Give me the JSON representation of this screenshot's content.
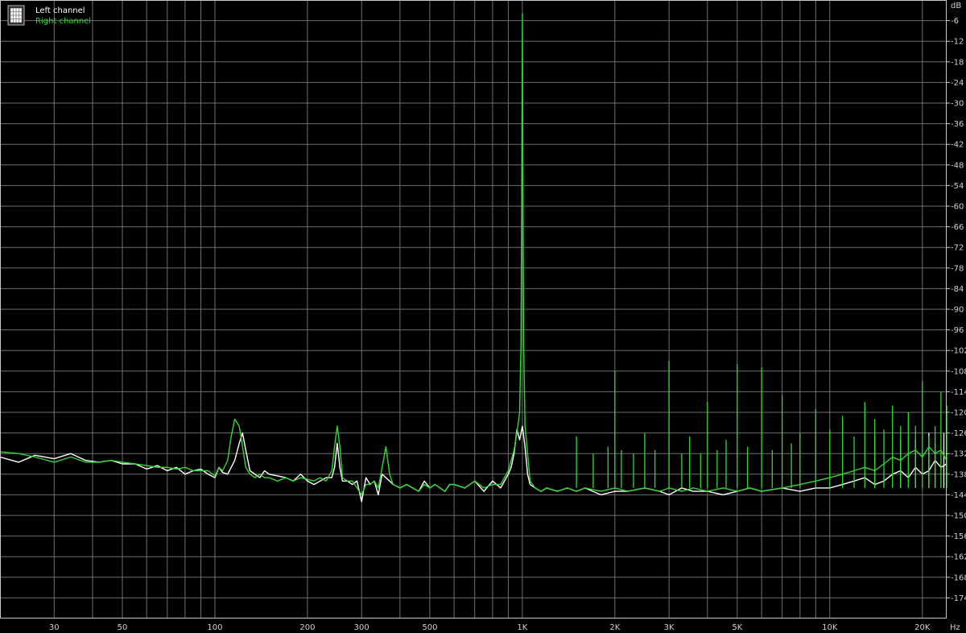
{
  "chart_data": {
    "type": "line",
    "xscale": "log",
    "xlim": [
      20,
      24000
    ],
    "ylim": [
      -180,
      0
    ],
    "grid": true,
    "legend": "top-left",
    "legend_icon": "grid-icon",
    "y_unit": "dB",
    "x_unit": "Hz",
    "x_ticks": [
      {
        "value": 30,
        "label": "30"
      },
      {
        "value": 50,
        "label": "50"
      },
      {
        "value": 100,
        "label": "100"
      },
      {
        "value": 200,
        "label": "200"
      },
      {
        "value": 300,
        "label": "300"
      },
      {
        "value": 500,
        "label": "500"
      },
      {
        "value": 1000,
        "label": "1K"
      },
      {
        "value": 2000,
        "label": "2K"
      },
      {
        "value": 3000,
        "label": "3K"
      },
      {
        "value": 5000,
        "label": "5K"
      },
      {
        "value": 10000,
        "label": "10K"
      },
      {
        "value": 20000,
        "label": "20K"
      }
    ],
    "x_grid": [
      20,
      30,
      40,
      50,
      60,
      70,
      80,
      90,
      100,
      200,
      300,
      400,
      500,
      600,
      700,
      800,
      900,
      1000,
      2000,
      3000,
      4000,
      5000,
      6000,
      7000,
      8000,
      9000,
      10000,
      20000
    ],
    "y_ticks": [
      -6,
      -12,
      -18,
      -24,
      -30,
      -36,
      -42,
      -48,
      -54,
      -60,
      -66,
      -72,
      -78,
      -84,
      -90,
      -96,
      -102,
      -108,
      -114,
      -120,
      -126,
      -132,
      -138,
      -144,
      -150,
      -156,
      -162,
      -168,
      -174
    ],
    "series": [
      {
        "name": "Left channel",
        "color": "#ffffff",
        "x": [
          20,
          23,
          26,
          30,
          34,
          38,
          42,
          46,
          50,
          55,
          60,
          65,
          70,
          75,
          80,
          85,
          90,
          95,
          100,
          103,
          106,
          110,
          113,
          116,
          120,
          123,
          126,
          130,
          135,
          140,
          145,
          150,
          160,
          170,
          180,
          190,
          200,
          210,
          220,
          230,
          240,
          245,
          250,
          255,
          260,
          270,
          280,
          290,
          300,
          310,
          320,
          330,
          340,
          350,
          360,
          370,
          380,
          400,
          420,
          440,
          460,
          480,
          500,
          520,
          540,
          560,
          580,
          600,
          650,
          700,
          750,
          800,
          850,
          900,
          920,
          940,
          960,
          980,
          1000,
          1020,
          1040,
          1060,
          1100,
          1150,
          1200,
          1300,
          1400,
          1500,
          1600,
          1800,
          2000,
          2200,
          2500,
          2800,
          3000,
          3300,
          3600,
          4000,
          4500,
          5000,
          5500,
          6000,
          7000,
          8000,
          9000,
          10000,
          11000,
          12000,
          13000,
          14000,
          15000,
          16000,
          17000,
          18000,
          19000,
          20000,
          21000,
          22000,
          23000,
          24000
        ],
        "y": [
          -133,
          -134.5,
          -132.5,
          -133.5,
          -132,
          -134,
          -134.5,
          -134,
          -135,
          -135,
          -136.5,
          -135.5,
          -137,
          -136,
          -138,
          -137,
          -136.5,
          -138,
          -139,
          -136,
          -137.5,
          -138,
          -136,
          -134,
          -129,
          -126,
          -131,
          -137,
          -138,
          -139,
          -137,
          -138,
          -138.5,
          -139,
          -140,
          -138,
          -140,
          -141,
          -140,
          -139,
          -139,
          -136,
          -129,
          -136,
          -140,
          -140,
          -141,
          -140,
          -146,
          -139,
          -141,
          -140,
          -144,
          -138,
          -139,
          -140,
          -141,
          -142,
          -141,
          -142,
          -143,
          -140,
          -142,
          -141,
          -142,
          -143,
          -141,
          -141,
          -142,
          -140,
          -143,
          -140,
          -142,
          -138,
          -136,
          -132,
          -125,
          -128,
          -124,
          -130,
          -138,
          -141,
          -142,
          -143,
          -142,
          -143,
          -142,
          -143,
          -142,
          -144,
          -143,
          -143,
          -142,
          -143,
          -144,
          -142,
          -143,
          -143,
          -144,
          -143,
          -142,
          -143,
          -142,
          -143,
          -142,
          -142,
          -141,
          -140,
          -139,
          -141,
          -140,
          -138,
          -137,
          -139,
          -136,
          -138,
          -137,
          -134,
          -136,
          -135
        ]
      },
      {
        "name": "Right channel",
        "color": "#33d633",
        "x": [
          20,
          23,
          26,
          30,
          34,
          38,
          42,
          46,
          50,
          55,
          60,
          65,
          70,
          75,
          80,
          85,
          90,
          95,
          100,
          103,
          106,
          110,
          113,
          116,
          120,
          123,
          126,
          130,
          135,
          140,
          145,
          150,
          160,
          170,
          180,
          190,
          200,
          210,
          220,
          230,
          240,
          245,
          250,
          255,
          260,
          270,
          280,
          290,
          300,
          310,
          320,
          330,
          340,
          350,
          360,
          370,
          380,
          400,
          420,
          440,
          460,
          480,
          500,
          520,
          540,
          560,
          580,
          600,
          650,
          700,
          750,
          800,
          850,
          900,
          920,
          940,
          960,
          980,
          990,
          995,
          1000,
          1005,
          1010,
          1020,
          1040,
          1060,
          1100,
          1150,
          1200,
          1300,
          1400,
          1500,
          1600,
          1800,
          2000,
          2200,
          2500,
          2800,
          3000,
          3300,
          3600,
          4000,
          4500,
          5000,
          5500,
          6000,
          7000,
          8000,
          9000,
          10000,
          11000,
          12000,
          13000,
          14000,
          15000,
          16000,
          17000,
          18000,
          19000,
          20000,
          21000,
          22000,
          23000,
          24000
        ],
        "y": [
          -131.5,
          -132,
          -133,
          -134.5,
          -133,
          -134.5,
          -134.5,
          -134,
          -134.5,
          -135,
          -135.5,
          -136,
          -136,
          -136.5,
          -136,
          -137,
          -137,
          -137,
          -138.5,
          -136,
          -137,
          -134,
          -127,
          -122,
          -124,
          -130,
          -136,
          -138,
          -139,
          -138,
          -139,
          -139,
          -140,
          -139,
          -140,
          -139,
          -139.5,
          -140,
          -139,
          -140,
          -137,
          -130,
          -124,
          -130,
          -139,
          -140,
          -140,
          -142,
          -144,
          -141,
          -141,
          -140,
          -142,
          -136,
          -130,
          -138,
          -141,
          -142,
          -141,
          -142,
          -143,
          -141,
          -142,
          -141,
          -142,
          -143,
          -141,
          -141,
          -142,
          -140,
          -142,
          -141,
          -141,
          -137,
          -134,
          -131,
          -126,
          -120,
          -100,
          -60,
          -4,
          -60,
          -100,
          -124,
          -132,
          -140,
          -142,
          -143,
          -142,
          -143,
          -142,
          -143,
          -142,
          -143,
          -142,
          -143,
          -142,
          -143,
          -142,
          -143,
          -142,
          -143,
          -142,
          -143,
          -142,
          -143,
          -142,
          -141,
          -140,
          -139,
          -138,
          -137,
          -136,
          -137,
          -135,
          -133,
          -134,
          -132,
          -131,
          -133,
          -130,
          -132,
          -131,
          -134
        ]
      }
    ],
    "harmonics_right": [
      {
        "x": 1500,
        "y": -127
      },
      {
        "x": 1700,
        "y": -132
      },
      {
        "x": 1900,
        "y": -130
      },
      {
        "x": 2000,
        "y": -108
      },
      {
        "x": 2100,
        "y": -131
      },
      {
        "x": 2300,
        "y": -132
      },
      {
        "x": 2500,
        "y": -126
      },
      {
        "x": 2700,
        "y": -131
      },
      {
        "x": 3000,
        "y": -105
      },
      {
        "x": 3300,
        "y": -132
      },
      {
        "x": 3500,
        "y": -127
      },
      {
        "x": 3800,
        "y": -132
      },
      {
        "x": 4000,
        "y": -117
      },
      {
        "x": 4300,
        "y": -131
      },
      {
        "x": 4600,
        "y": -128
      },
      {
        "x": 5000,
        "y": -106
      },
      {
        "x": 5400,
        "y": -130
      },
      {
        "x": 6000,
        "y": -107
      },
      {
        "x": 6500,
        "y": -131
      },
      {
        "x": 7000,
        "y": -115
      },
      {
        "x": 7500,
        "y": -129
      },
      {
        "x": 8000,
        "y": -126
      },
      {
        "x": 9000,
        "y": -119
      },
      {
        "x": 10000,
        "y": -125
      },
      {
        "x": 11000,
        "y": -121
      },
      {
        "x": 12000,
        "y": -127
      },
      {
        "x": 13000,
        "y": -117
      },
      {
        "x": 14000,
        "y": -122
      },
      {
        "x": 15000,
        "y": -125
      },
      {
        "x": 16000,
        "y": -118
      },
      {
        "x": 17000,
        "y": -124
      },
      {
        "x": 18000,
        "y": -120
      },
      {
        "x": 19000,
        "y": -124
      },
      {
        "x": 20000,
        "y": -111
      },
      {
        "x": 21000,
        "y": -127
      },
      {
        "x": 22000,
        "y": -124
      },
      {
        "x": 23000,
        "y": -114
      },
      {
        "x": 24000,
        "y": -118
      }
    ],
    "harmonics_left": [
      {
        "x": 14000,
        "y": -127
      },
      {
        "x": 17000,
        "y": -128
      },
      {
        "x": 19000,
        "y": -128
      },
      {
        "x": 21000,
        "y": -126
      },
      {
        "x": 22000,
        "y": -129
      },
      {
        "x": 23500,
        "y": -126
      }
    ]
  }
}
